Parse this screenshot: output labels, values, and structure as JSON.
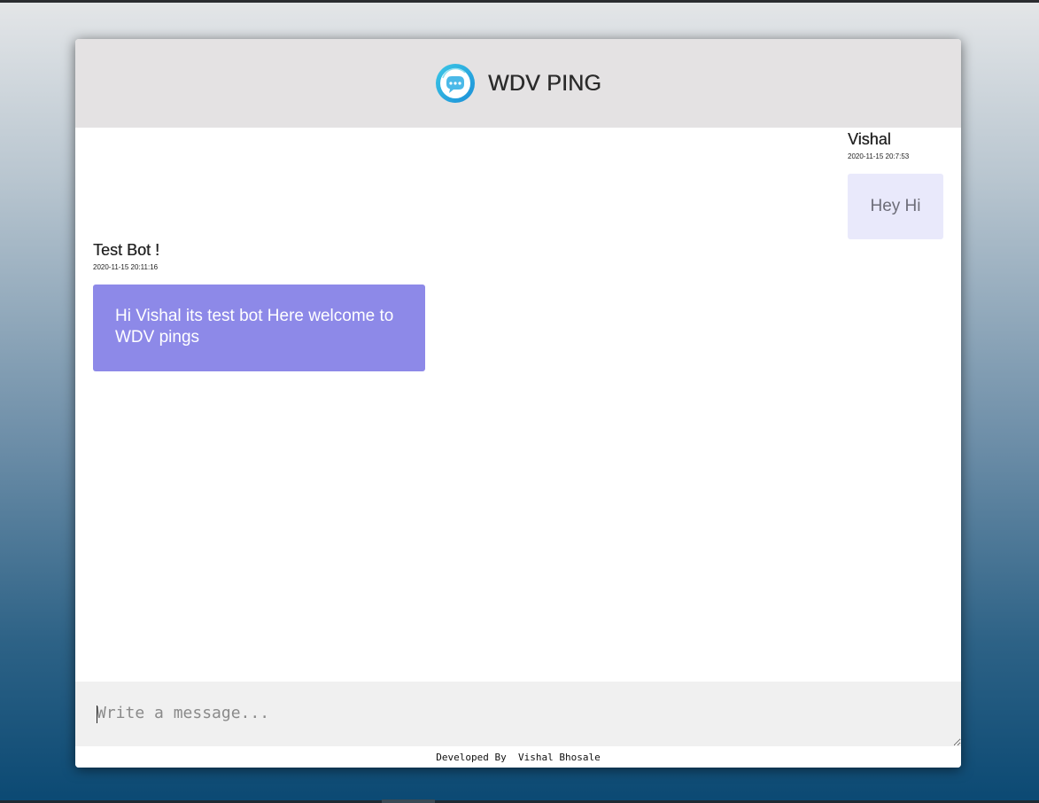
{
  "header": {
    "title": "WDV PING",
    "logo_icon": "chat-bubble-icon"
  },
  "messages": [
    {
      "sender": "Vishal",
      "timestamp": "2020-11-15 20:7:53",
      "text": "Hey Hi",
      "direction": "sent"
    },
    {
      "sender": "Test Bot !",
      "timestamp": "2020-11-15 20:11:16",
      "text": "Hi Vishal its test bot Here welcome to WDV pings",
      "direction": "received"
    }
  ],
  "composer": {
    "placeholder": "Write a message..."
  },
  "footer": {
    "prefix": "Developed By ",
    "author": "Vishal Bhosale"
  },
  "colors": {
    "header_bg": "#e4e2e3",
    "sent_bubble": "#e9e9fb",
    "received_bubble": "#8d89e8",
    "composer_bg": "#f0f0f0"
  }
}
